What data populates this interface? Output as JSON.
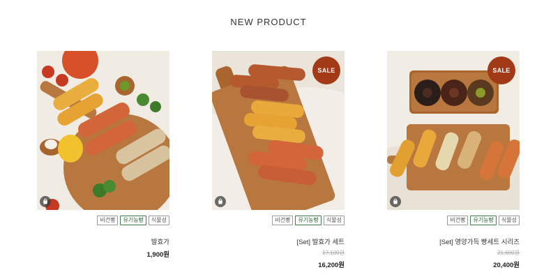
{
  "section": {
    "title": "NEW PRODUCT"
  },
  "products": [
    {
      "sale_label": "SALE",
      "tags": [
        "식물성",
        "유기농빵",
        "비건빵"
      ],
      "name": "[Set] 영양가득 빵세트 시리즈",
      "original_price": "21,600원",
      "price": "20,400원"
    },
    {
      "sale_label": "SALE",
      "tags": [
        "식물성",
        "유기농빵",
        "비건빵"
      ],
      "name": "[Set] 발효가 세트",
      "original_price": "17,100원",
      "price": "16,200원"
    },
    {
      "tags": [
        "식물성",
        "유기농빵",
        "비건빵"
      ],
      "name": "발효가",
      "price": "1,900원"
    }
  ],
  "colors": {
    "sale_badge": "#a23a18",
    "tag_green": "#3f7a4a",
    "board_wood": "#b8773f"
  },
  "icons": {
    "cart": "shopping-bag-icon"
  }
}
